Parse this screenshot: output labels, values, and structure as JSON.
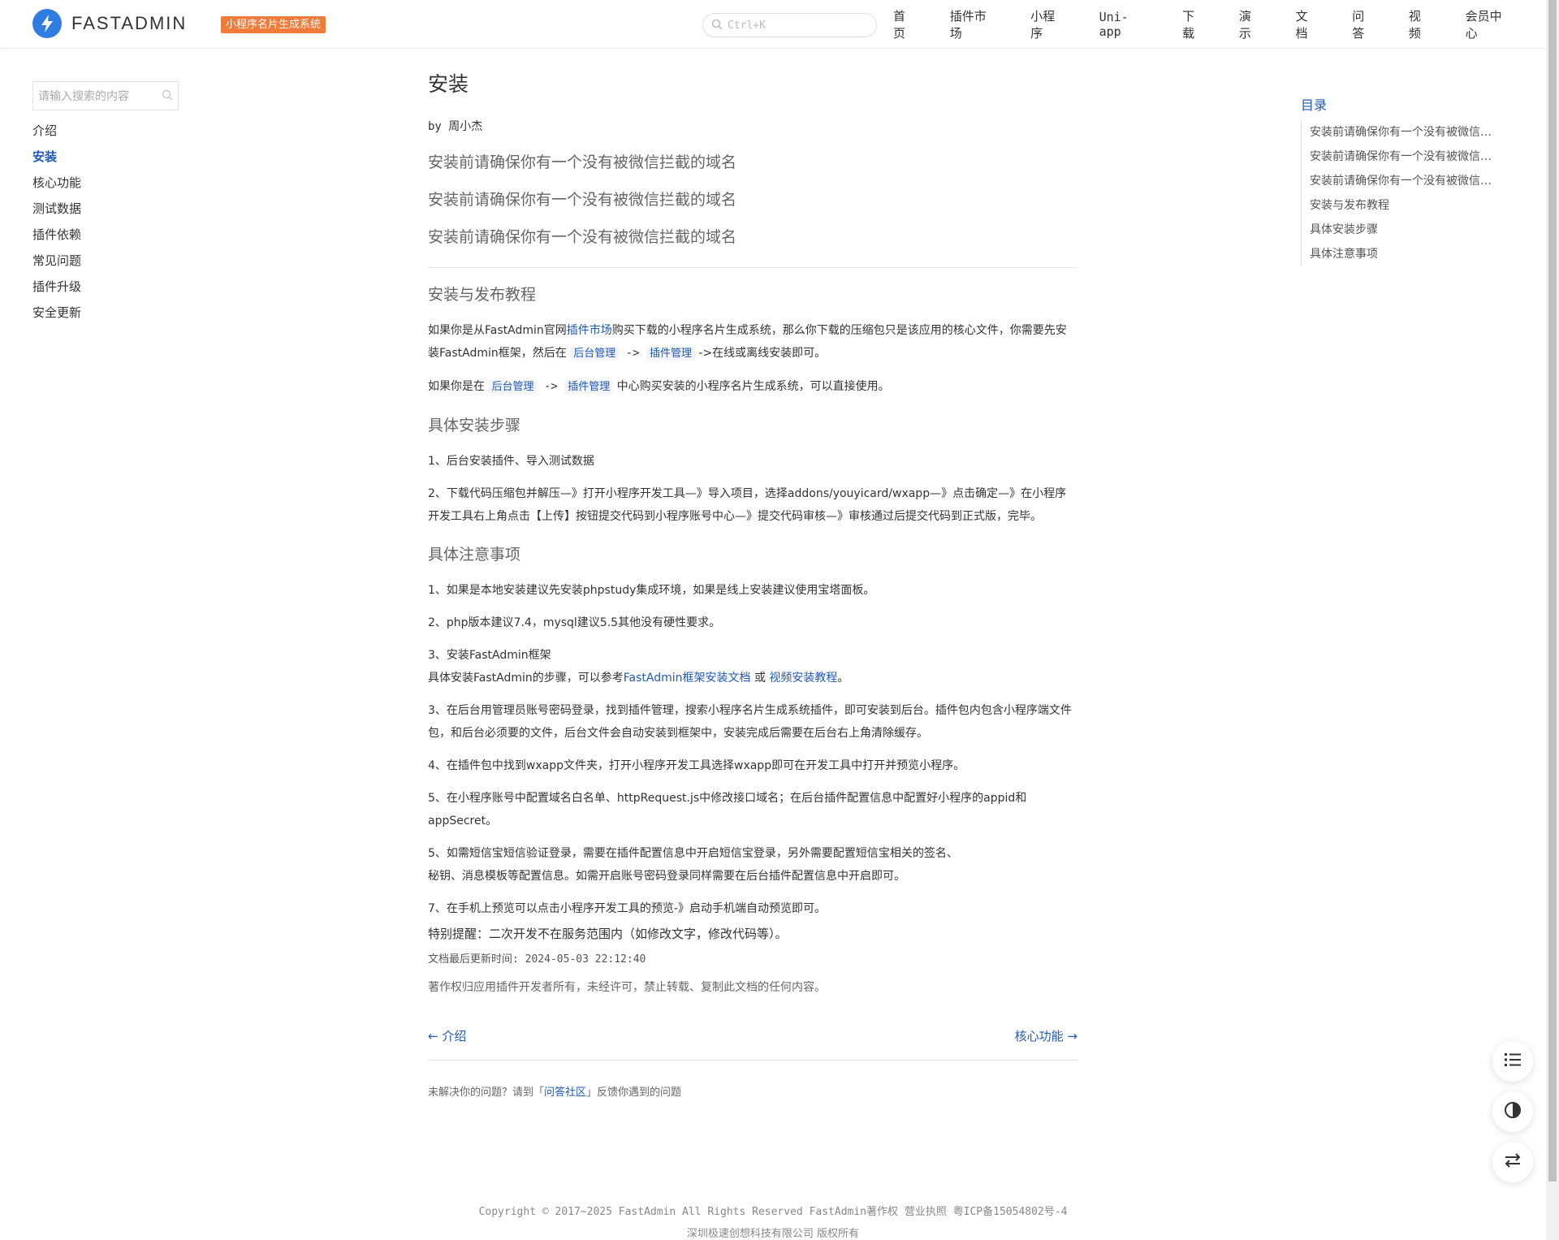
{
  "header": {
    "brand": "FASTADMIN",
    "plugin_badge": "小程序名片生成系统",
    "search_placeholder": "Ctrl+K",
    "nav": [
      "首页",
      "插件市场",
      "小程序",
      "Uni-app",
      "下载",
      "演示",
      "文档",
      "问答",
      "视频",
      "会员中心"
    ]
  },
  "sidebar": {
    "search_placeholder": "请输入搜索的内容",
    "items": [
      {
        "label": "介绍",
        "active": false
      },
      {
        "label": "安装",
        "active": true
      },
      {
        "label": "核心功能",
        "active": false
      },
      {
        "label": "测试数据",
        "active": false
      },
      {
        "label": "插件依赖",
        "active": false
      },
      {
        "label": "常见问题",
        "active": false
      },
      {
        "label": "插件升级",
        "active": false
      },
      {
        "label": "安全更新",
        "active": false
      }
    ]
  },
  "article": {
    "title": "安装",
    "by_prefix": "by",
    "author": "周小杰",
    "domain_notes": [
      "安装前请确保你有一个没有被微信拦截的域名",
      "安装前请确保你有一个没有被微信拦截的域名",
      "安装前请确保你有一个没有被微信拦截的域名"
    ],
    "sec1": {
      "heading": "安装与发布教程",
      "p1_a": "如果你是从FastAdmin官网",
      "p1_link": "插件市场",
      "p1_b": "购买下载的小程序名片生成系统，那么你下载的压缩包只是该应用的核心文件，你需要先安装FastAdmin框架，然后在 ",
      "p1_code1": "后台管理",
      "p1_arrow1": " -> ",
      "p1_code2": "插件管理",
      "p1_c": " ->在线或离线安装即可。",
      "p2_a": "如果你是在 ",
      "p2_code1": "后台管理",
      "p2_arrow": " -> ",
      "p2_code2": "插件管理",
      "p2_b": " 中心购买安装的小程序名片生成系统，可以直接使用。"
    },
    "sec2": {
      "heading": "具体安装步骤",
      "step1": "1、后台安装插件、导入测试数据",
      "step2": "2、下载代码压缩包并解压—》打开小程序开发工具—》导入项目，选择addons/youyicard/wxapp—》点击确定—》在小程序开发工具右上角点击【上传】按钮提交代码到小程序账号中心—》提交代码审核—》审核通过后提交代码到正式版，完毕。"
    },
    "sec3": {
      "heading": "具体注意事项",
      "n1": "1、如果是本地安装建议先安装phpstudy集成环境，如果是线上安装建议使用宝塔面板。",
      "n2": "2、php版本建议7.4，mysql建议5.5其他没有硬性要求。",
      "n3_title": "3、安装FastAdmin框架",
      "n3_a": "具体安装FastAdmin的步骤，可以参考",
      "n3_link1": "FastAdmin框架安装文档",
      "n3_or": " 或 ",
      "n3_link2": "视频安装教程",
      "n3_end": "。",
      "n4": "3、在后台用管理员账号密码登录，找到插件管理，搜索小程序名片生成系统插件，即可安装到后台。插件包内包含小程序端文件包，和后台必须要的文件，后台文件会自动安装到框架中，安装完成后需要在后台右上角清除缓存。",
      "n5": "4、在插件包中找到wxapp文件夹，打开小程序开发工具选择wxapp即可在开发工具中打开并预览小程序。",
      "n6": "5、在小程序账号中配置域名白名单、httpRequest.js中修改接口域名；在后台插件配置信息中配置好小程序的appid和appSecret。",
      "n7_a": "5、如需短信宝短信验证登录，需要在插件配置信息中开启短信宝登录，另外需要配置短信宝相关的签名、",
      "n7_b": "秘钥、消息模板等配置信息。如需开启账号密码登录同样需要在后台插件配置信息中开启即可。",
      "n8": "7、在手机上预览可以点击小程序开发工具的预览-》启动手机端自动预览即可。"
    },
    "notice": "特别提醒：二次开发不在服务范围内（如修改文字，修改代码等）。",
    "updated_label": "文档最后更新时间:",
    "updated_value": "2024-05-03 22:12:40",
    "copyright_note": "著作权归应用插件开发者所有，未经许可，禁止转载、复制此文档的任何内容。",
    "prev": "← 介绍",
    "next": "核心功能 →",
    "help_a": "未解决你的问题？请到「",
    "help_link": "问答社区",
    "help_b": "」反馈你遇到的问题"
  },
  "toc": {
    "title": "目录",
    "items": [
      "安装前请确保你有一个没有被微信拦截的域名",
      "安装前请确保你有一个没有被微信拦截的域名",
      "安装前请确保你有一个没有被微信拦截的域名",
      "安装与发布教程",
      "具体安装步骤",
      "具体注意事项"
    ]
  },
  "footer": {
    "line1": "Copyright © 2017~2025 FastAdmin All Rights Reserved FastAdmin著作权 营业执照 粤ICP备15054802号-4",
    "line2": "深圳极速创想科技有限公司 版权所有"
  },
  "icons": {
    "logo": "lightning-bolt-icon",
    "search": "search-icon",
    "fab1": "list-icon",
    "fab2": "contrast-icon",
    "fab3": "swap-icon"
  },
  "colors": {
    "link": "#2059b8",
    "badge": "#f07a3a",
    "logo": "#2f7de1"
  }
}
